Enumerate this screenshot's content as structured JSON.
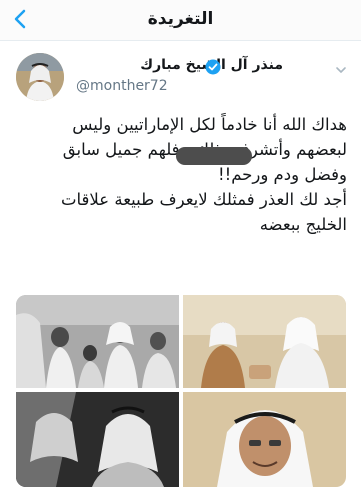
{
  "header": {
    "title": "التغريدة"
  },
  "author": {
    "name": "منذر آل الشيخ مبارك",
    "handle": "@monther72"
  },
  "tweet": {
    "lines": [
      "هداك الله أنا خادماً لكل الإماراتيين وليس",
      "لبعضهم وأتشرف بذلك ، فلهم جميل سابق",
      "وفضل ودم ورحم!!",
      "أجد لك العذر فمثلك لايعرف طبيعة علاقات",
      "الخليج ببعضه"
    ]
  },
  "colors": {
    "accent": "#1da1f2",
    "text": "#14171a",
    "muted": "#657786"
  },
  "icons": {
    "back": "chevron-left-icon",
    "verified": "verified-badge-icon",
    "more": "chevron-down-icon"
  }
}
